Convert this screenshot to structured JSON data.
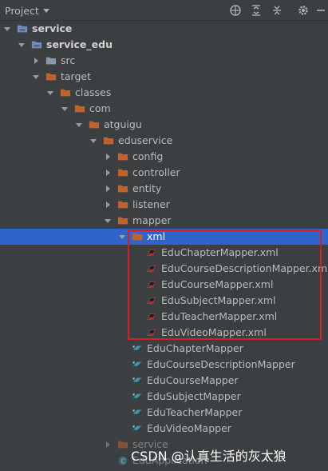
{
  "toolbar": {
    "title": "Project",
    "icons": [
      "globe-icon",
      "expand-all-icon",
      "collapse-all-icon",
      "gear-icon",
      "minimize-icon"
    ]
  },
  "tree": [
    {
      "label": "service",
      "icon": "module-folder",
      "expanded": true,
      "bold": true
    },
    {
      "label": "service_edu",
      "icon": "module-folder",
      "expanded": true,
      "bold": true
    },
    {
      "label": "src",
      "icon": "folder",
      "expanded": false
    },
    {
      "label": "target",
      "icon": "folder-orange",
      "expanded": true
    },
    {
      "label": "classes",
      "icon": "folder-orange",
      "expanded": true
    },
    {
      "label": "com",
      "icon": "folder-orange",
      "expanded": true
    },
    {
      "label": "atguigu",
      "icon": "folder-orange",
      "expanded": true
    },
    {
      "label": "eduservice",
      "icon": "folder-orange",
      "expanded": true
    },
    {
      "label": "config",
      "icon": "folder-orange",
      "expanded": false
    },
    {
      "label": "controller",
      "icon": "folder-orange",
      "expanded": false
    },
    {
      "label": "entity",
      "icon": "folder-orange",
      "expanded": false
    },
    {
      "label": "listener",
      "icon": "folder-orange",
      "expanded": false
    },
    {
      "label": "mapper",
      "icon": "folder-orange",
      "expanded": true
    },
    {
      "label": "xml",
      "icon": "folder-orange",
      "expanded": true,
      "selected": true
    },
    {
      "label": "EduChapterMapper.xml",
      "icon": "xml-file"
    },
    {
      "label": "EduCourseDescriptionMapper.xml",
      "icon": "xml-file"
    },
    {
      "label": "EduCourseMapper.xml",
      "icon": "xml-file"
    },
    {
      "label": "EduSubjectMapper.xml",
      "icon": "xml-file"
    },
    {
      "label": "EduTeacherMapper.xml",
      "icon": "xml-file"
    },
    {
      "label": "EduVideoMapper.xml",
      "icon": "xml-file"
    },
    {
      "label": "EduChapterMapper",
      "icon": "class-file"
    },
    {
      "label": "EduCourseDescriptionMapper",
      "icon": "class-file"
    },
    {
      "label": "EduCourseMapper",
      "icon": "class-file"
    },
    {
      "label": "EduSubjectMapper",
      "icon": "class-file"
    },
    {
      "label": "EduTeacherMapper",
      "icon": "class-file"
    },
    {
      "label": "EduVideoMapper",
      "icon": "class-file"
    },
    {
      "label": "service",
      "icon": "folder-orange",
      "expanded": false
    },
    {
      "label": "EduApplication",
      "icon": "app-class-file"
    }
  ],
  "watermark": "CSDN @认真生活的灰太狼",
  "colors": {
    "background": "#3c3f41",
    "selection": "#2f65ca",
    "folder": "#c0622b",
    "highlight": "#d51f26"
  }
}
